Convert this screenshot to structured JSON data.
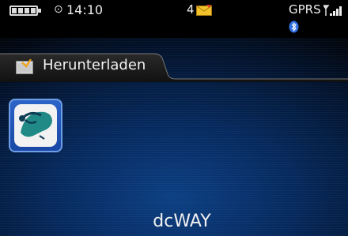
{
  "status_bar": {
    "time": "14:10",
    "message_count": "4",
    "network": "GPRS",
    "icons": {
      "battery": "battery-icon",
      "alarm": "alarm-clock-icon",
      "message": "envelope-icon",
      "signal": "signal-bars-icon",
      "bluetooth": "bluetooth-icon"
    },
    "alarm_glyph": "⊙"
  },
  "folder": {
    "label": "Herunterladen",
    "icon": "folder-icon"
  },
  "focused_app": {
    "name": "dcWAY",
    "icon": "dcway-app-icon"
  },
  "colors": {
    "background_glow": "#0c3f83",
    "selection_border": "#6d9ee6",
    "app_icon_bg": "#f2f2f2",
    "app_icon_teal": "#1f8a86"
  }
}
